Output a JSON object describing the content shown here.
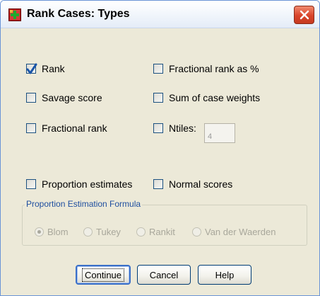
{
  "window": {
    "title": "Rank Cases: Types"
  },
  "checkboxes": {
    "rank": {
      "label": "Rank",
      "checked": true
    },
    "savage_score": {
      "label": "Savage score",
      "checked": false
    },
    "fractional_rank": {
      "label": "Fractional rank",
      "checked": false
    },
    "fractional_rank_pct": {
      "label": "Fractional rank as %",
      "checked": false
    },
    "sum_case_weights": {
      "label": "Sum of case weights",
      "checked": false
    },
    "ntiles": {
      "label": "Ntiles:",
      "checked": false,
      "value": "4"
    },
    "proportion_estimates": {
      "label": "Proportion estimates",
      "checked": false
    },
    "normal_scores": {
      "label": "Normal scores",
      "checked": false
    }
  },
  "formula": {
    "legend": "Proportion Estimation Formula",
    "options": [
      "Blom",
      "Tukey",
      "Rankit",
      "Van der Waerden"
    ],
    "selected": "Blom"
  },
  "buttons": {
    "continue": "Continue",
    "cancel": "Cancel",
    "help": "Help"
  },
  "colors": {
    "title_blue": "#1e4e9f",
    "checkmark": "#1a8a1a"
  }
}
